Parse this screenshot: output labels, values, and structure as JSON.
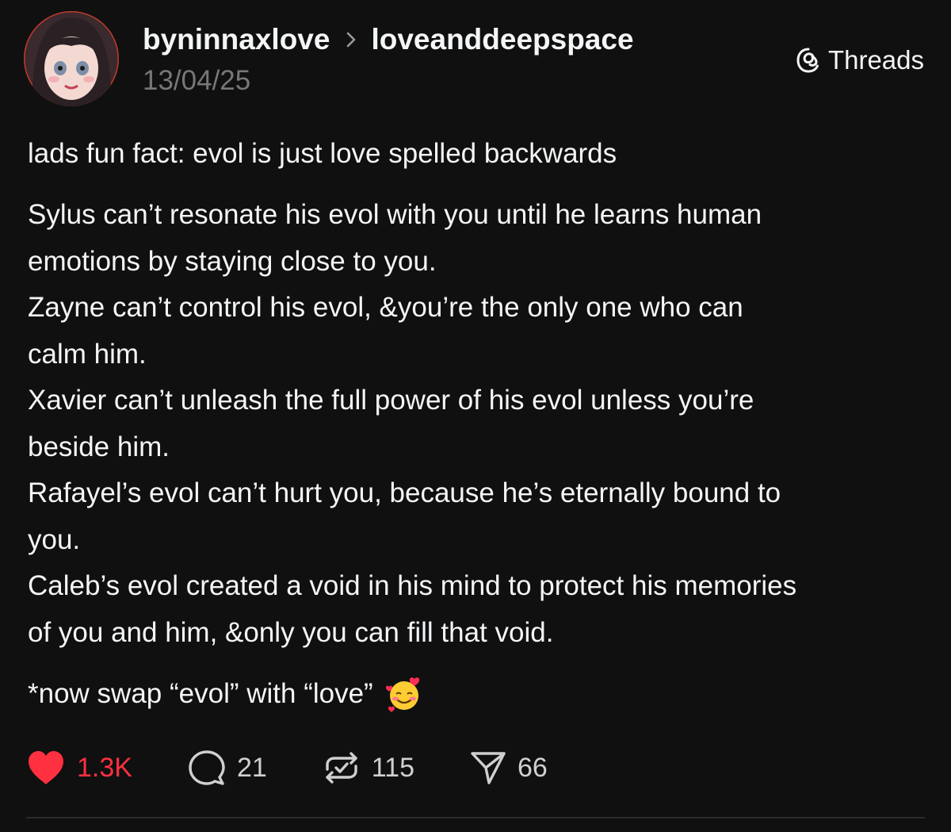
{
  "post": {
    "author": "byninnaxlove",
    "community": "loveanddeepspace",
    "timestamp": "13/04/25",
    "brand": "Threads",
    "lead": "lads fun fact: evol is just love spelled backwards",
    "lines": [
      "Sylus can’t resonate his evol with you until he learns human",
      "emotions by staying close to you.",
      "Zayne can’t control his evol, &you’re the only one who can",
      "calm him.",
      "Xavier can’t unleash the full power of his evol unless you’re",
      "beside him.",
      "Rafayel’s evol can’t hurt you, because he’s eternally bound to",
      "you.",
      "Caleb’s evol created a void in his mind to protect his memories",
      "of you and him, &only you can fill that void."
    ],
    "tail": "*now swap “evol” with “love”",
    "tail_emoji": "smiling-face-with-hearts-icon"
  },
  "actions": {
    "likes": "1.3K",
    "replies": "21",
    "reposts": "115",
    "shares": "66"
  },
  "colors": {
    "background": "#101010",
    "text": "#f3f5f7",
    "muted": "#777777",
    "like": "#ff3040"
  }
}
